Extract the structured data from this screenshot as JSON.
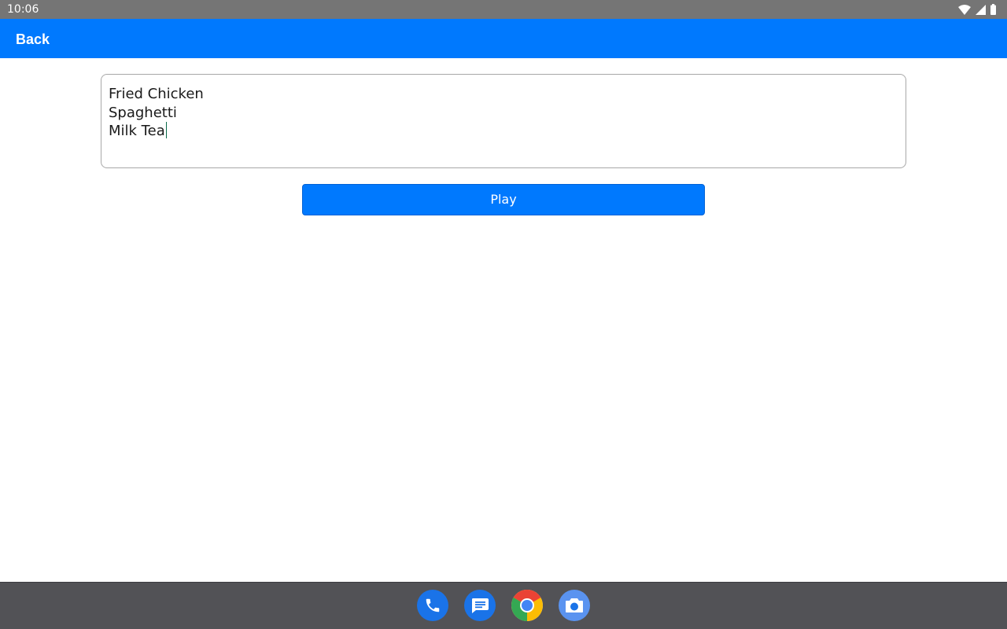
{
  "status_bar": {
    "time": "10:06",
    "icons": [
      "wifi-icon",
      "signal-icon",
      "battery-icon"
    ]
  },
  "app_bar": {
    "back_label": "Back",
    "color": "#0079fe"
  },
  "editor": {
    "lines": [
      "Fried Chicken",
      "Spaghetti",
      "Milk Tea"
    ]
  },
  "play_button": {
    "label": "Play",
    "color": "#0079fe"
  },
  "dock": {
    "apps": [
      "phone-icon",
      "messages-icon",
      "chrome-icon",
      "camera-icon"
    ]
  }
}
